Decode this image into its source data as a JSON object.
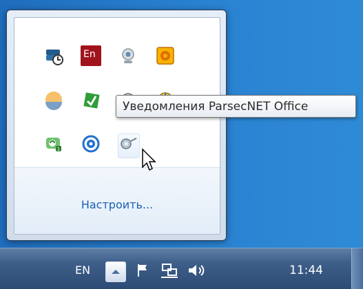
{
  "tooltip": {
    "text": "Уведомления ParsecNET Office"
  },
  "popup": {
    "customize_link": "Настроить..."
  },
  "tray_icons": [
    {
      "name": "sync-schedule-icon",
      "label": ""
    },
    {
      "name": "en-app-icon",
      "label": "En"
    },
    {
      "name": "webcam-icon",
      "label": ""
    },
    {
      "name": "office-icon",
      "label": ""
    },
    {
      "name": "weather-icon",
      "label": ""
    },
    {
      "name": "green-network-icon",
      "label": ""
    },
    {
      "name": "parsec-notify-icon",
      "label": ""
    },
    {
      "name": "globe-icon",
      "label": ""
    },
    {
      "name": "green-update-icon",
      "label": ""
    },
    {
      "name": "blue-circle-icon",
      "label": ""
    }
  ],
  "taskbar": {
    "language": "EN",
    "time": "11:44"
  }
}
